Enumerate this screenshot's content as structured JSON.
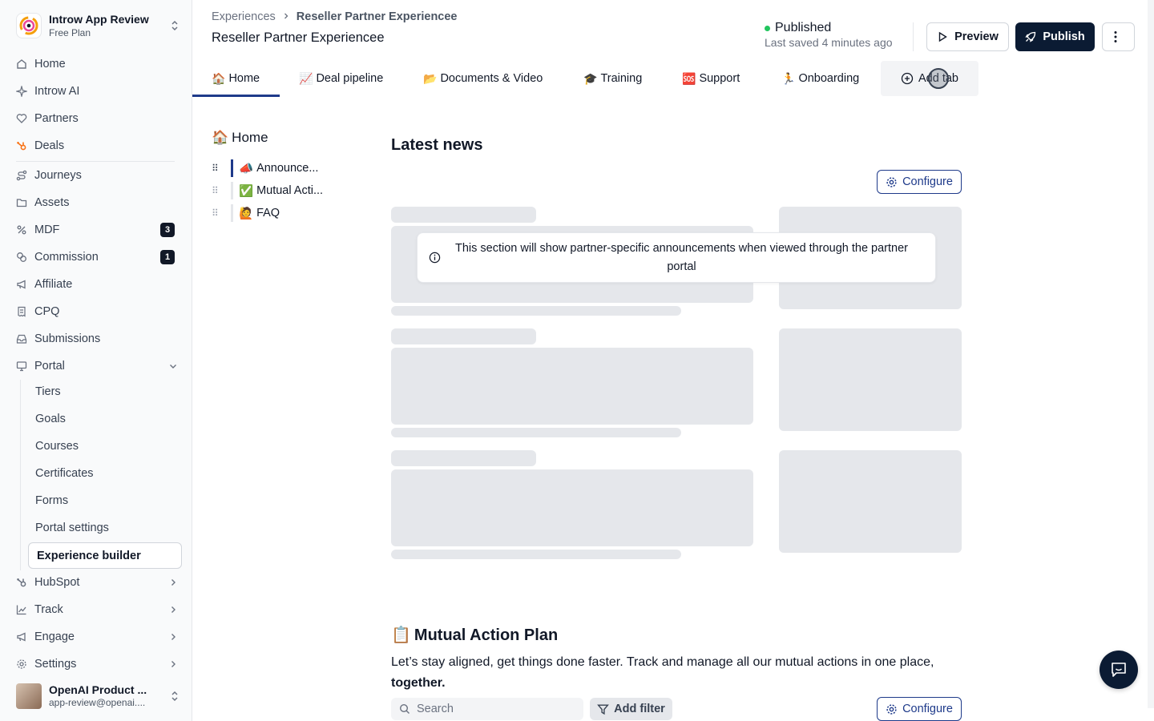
{
  "org": {
    "name": "Introw App Review",
    "plan": "Free Plan"
  },
  "sidebar": {
    "items": [
      {
        "label": "Home",
        "icon": "home-icon"
      },
      {
        "label": "Introw AI",
        "icon": "sparkle-icon"
      },
      {
        "label": "Partners",
        "icon": "handshake-icon"
      },
      {
        "label": "Deals",
        "icon": "hubspot-icon"
      },
      {
        "label": "Journeys",
        "icon": "route-icon"
      },
      {
        "label": "Assets",
        "icon": "folder-icon"
      },
      {
        "label": "MDF",
        "icon": "percent-icon",
        "badge": "3"
      },
      {
        "label": "Commission",
        "icon": "coins-icon",
        "badge": "1"
      },
      {
        "label": "Affiliate",
        "icon": "megaphone-icon"
      },
      {
        "label": "CPQ",
        "icon": "receipt-icon"
      },
      {
        "label": "Submissions",
        "icon": "inbox-icon"
      },
      {
        "label": "Portal",
        "icon": "monitor-icon"
      }
    ],
    "portal_sub": [
      {
        "label": "Tiers"
      },
      {
        "label": "Goals"
      },
      {
        "label": "Courses"
      },
      {
        "label": "Certificates"
      },
      {
        "label": "Forms"
      },
      {
        "label": "Portal settings"
      },
      {
        "label": "Experience builder"
      }
    ],
    "bottom": [
      {
        "label": "HubSpot",
        "icon": "hubspot-icon"
      },
      {
        "label": "Track",
        "icon": "chart-icon"
      },
      {
        "label": "Engage",
        "icon": "megaphone-icon"
      },
      {
        "label": "Settings",
        "icon": "gear-icon"
      }
    ],
    "user": {
      "name": "OpenAI Product ...",
      "email": "app-review@openai...."
    }
  },
  "breadcrumb": {
    "parent": "Experiences",
    "current": "Reseller Partner Experiencee"
  },
  "page_title": "Reseller Partner Experiencee",
  "status": {
    "label": "Published",
    "saved": "Last saved 4 minutes ago",
    "color": "#22c55e"
  },
  "actions": {
    "preview": "Preview",
    "publish": "Publish"
  },
  "tabs": [
    {
      "emoji": "🏠",
      "label": "Home"
    },
    {
      "emoji": "📈",
      "label": "Deal pipeline"
    },
    {
      "emoji": "📂",
      "label": "Documents & Video"
    },
    {
      "emoji": "🎓",
      "label": "Training"
    },
    {
      "emoji": "🆘",
      "label": "Support"
    },
    {
      "emoji": "🏃",
      "label": "Onboarding"
    }
  ],
  "add_tab": "Add tab",
  "tree": {
    "title_emoji": "🏠",
    "title": "Home",
    "items": [
      {
        "emoji": "📣",
        "label": "Announce..."
      },
      {
        "emoji": "✅",
        "label": "Mutual Acti..."
      },
      {
        "emoji": "🙋",
        "label": "FAQ"
      }
    ]
  },
  "news": {
    "title": "Latest news",
    "configure": "Configure",
    "notice": "This section will show partner-specific announcements when viewed through the partner portal"
  },
  "map": {
    "emoji": "📋",
    "title": "Mutual Action Plan",
    "desc": "Let’s stay aligned, get things done faster. Track and manage all our mutual actions in one place, ",
    "desc_bold": "together.",
    "search_placeholder": "Search",
    "add_filter": "Add filter",
    "configure": "Configure"
  },
  "colors": {
    "accent": "#1e3a8a",
    "primary_button": "#0b1b33",
    "skeleton": "#e5e7eb"
  }
}
